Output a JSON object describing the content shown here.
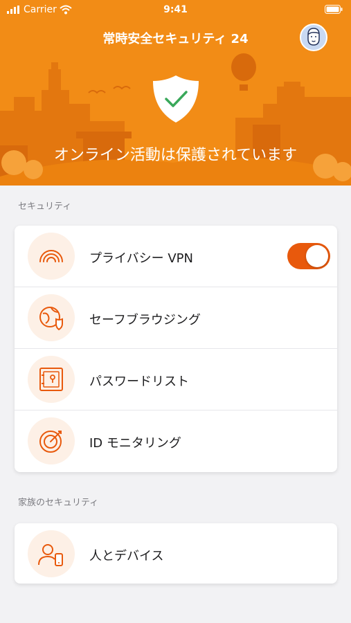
{
  "status_bar": {
    "carrier": "Carrier",
    "time": "9:41"
  },
  "header": {
    "title": "常時安全セキュリティ 24"
  },
  "hero": {
    "status_message": "オンライン活動は保護されています"
  },
  "sections": [
    {
      "label": "セキュリティ",
      "items": [
        {
          "label": "プライバシー VPN",
          "icon": "vpn-icon",
          "toggle_on": true
        },
        {
          "label": "セーフブラウジング",
          "icon": "safe-browsing-icon"
        },
        {
          "label": "パスワードリスト",
          "icon": "password-safe-icon"
        },
        {
          "label": "ID モニタリング",
          "icon": "id-monitoring-icon"
        }
      ]
    },
    {
      "label": "家族のセキュリティ",
      "items": [
        {
          "label": "人とデバイス",
          "icon": "people-devices-icon"
        }
      ]
    }
  ],
  "colors": {
    "hero_orange": "#f28c16",
    "accent": "#e8590c",
    "shield_check": "#39a85a",
    "background": "#f2f2f4"
  }
}
